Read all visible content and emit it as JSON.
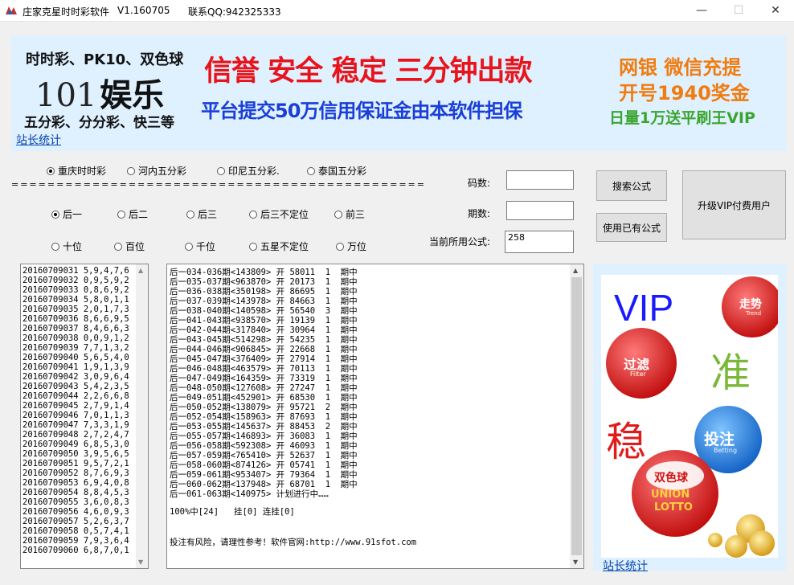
{
  "window": {
    "title": "庄家克星时时彩软件",
    "version": "V1.160705",
    "contact": "联系QQ:942325333",
    "minimize": "—",
    "maximize": "☐",
    "close": "✕"
  },
  "banner": {
    "line1": "时时彩、PK10、双色球",
    "logo_num": "101",
    "logo_text": "娱乐",
    "line3": "五分彩、分分彩、快三等",
    "slogan": "信誉 安全 稳定 三分钟出款",
    "guarantee": "平台提交50万信用保证金由本软件担保",
    "right1": "网银 微信充提",
    "right2": "开号1940奖金",
    "right3": "日量1万送平刷王VIP",
    "colors": {
      "red": "#e8141b",
      "blue": "#1a3fd6",
      "orange": "#f07c10",
      "green": "#3aa52e"
    }
  },
  "stats_link": "站长统计",
  "lottery_types": [
    {
      "label": "重庆时时彩",
      "selected": true
    },
    {
      "label": "河内五分彩",
      "selected": false
    },
    {
      "label": "印尼五分彩.",
      "selected": false
    },
    {
      "label": "泰国五分彩",
      "selected": false
    }
  ],
  "positions_row1": [
    {
      "label": "后一",
      "selected": true
    },
    {
      "label": "后二",
      "selected": false
    },
    {
      "label": "后三",
      "selected": false
    },
    {
      "label": "后三不定位",
      "selected": false
    },
    {
      "label": "前三",
      "selected": false
    }
  ],
  "positions_row2": [
    {
      "label": "十位",
      "selected": false
    },
    {
      "label": "百位",
      "selected": false
    },
    {
      "label": "千位",
      "selected": false
    },
    {
      "label": "五星不定位",
      "selected": false
    },
    {
      "label": "万位",
      "selected": false
    }
  ],
  "separator": "==============================================",
  "form": {
    "code_count_label": "码数:",
    "code_count_value": "",
    "period_label": "期数:",
    "period_value": "",
    "formula_label": "当前所用公式:",
    "formula_value": "258"
  },
  "buttons": {
    "search_formula": "搜索公式",
    "use_formula": "使用已有公式",
    "upgrade_vip": "升级VIP付费用户"
  },
  "history": [
    "20160709031 5,9,4,7,6",
    "20160709032 0,9,5,9,2",
    "20160709033 0,8,6,9,2",
    "20160709034 5,8,0,1,1",
    "20160709035 2,0,1,7,3",
    "20160709036 8,6,6,9,5",
    "20160709037 8,4,6,6,3",
    "20160709038 0,0,9,1,2",
    "20160709039 7,7,1,3,2",
    "20160709040 5,6,5,4,0",
    "20160709041 1,9,1,3,9",
    "20160709042 3,0,9,6,4",
    "20160709043 5,4,2,3,5",
    "20160709044 2,2,6,6,8",
    "20160709045 2,7,9,1,4",
    "20160709046 7,0,1,1,3",
    "20160709047 7,3,3,1,9",
    "20160709048 2,7,2,4,7",
    "20160709049 6,8,5,3,0",
    "20160709050 3,9,5,6,5",
    "20160709051 9,5,7,2,1",
    "20160709052 8,7,6,9,3",
    "20160709053 6,9,4,0,8",
    "20160709054 8,8,4,5,3",
    "20160709055 3,6,0,8,3",
    "20160709056 4,6,0,9,3",
    "20160709057 5,2,6,3,7",
    "20160709058 0,5,7,4,1",
    "20160709059 7,9,3,6,4",
    "20160709060 6,8,7,0,1"
  ],
  "results": [
    "后一034-036期<143809> 开 58011  1  期中",
    "后一035-037期<963870> 开 20173  1  期中",
    "后一036-038期<350198> 开 86695  1  期中",
    "后一037-039期<143978> 开 84663  1  期中",
    "后一038-040期<140598> 开 56540  3  期中",
    "后一041-043期<938570> 开 19139  1  期中",
    "后一042-044期<317840> 开 30964  1  期中",
    "后一043-045期<514298> 开 54235  1  期中",
    "后一044-046期<906845> 开 22668  1  期中",
    "后一045-047期<376409> 开 27914  1  期中",
    "后一046-048期<463579> 开 70113  1  期中",
    "后一047-049期<164359> 开 73319  1  期中",
    "后一048-050期<127608> 开 27247  1  期中",
    "后一049-051期<452901> 开 68530  1  期中",
    "后一050-052期<138079> 开 95721  2  期中",
    "后一052-054期<158963> 开 87693  1  期中",
    "后一053-055期<145637> 开 88453  2  期中",
    "后一055-057期<146893> 开 36083  1  期中",
    "后一056-058期<592308> 开 46093  1  期中",
    "后一057-059期<765410> 开 52637  1  期中",
    "后一058-060期<874126> 开 05741  1  期中",
    "后一059-061期<953407> 开 79364  1  期中",
    "后一060-062期<137948> 开 68701  1  期中",
    "后一061-063期<140975> 计划进行中……"
  ],
  "summary": "100%中[24]   挂[0] 连挂[0]",
  "disclaimer": "投注有风险，请理性参考！软件官网:http://www.91sfot.com",
  "ad": {
    "vip": "VIP",
    "zhun": "准",
    "wen": "稳",
    "ball_filter": "过滤",
    "ball_filter_en": "Filter",
    "ball_bet": "投注",
    "ball_bet_en": "Betting",
    "ball_trend": "走势",
    "ball_trend_en": "Trend",
    "lotto_cn": "双色球",
    "lotto_en1": "UNION",
    "lotto_en2": "LOTTO"
  },
  "ad_link": "站长统计"
}
